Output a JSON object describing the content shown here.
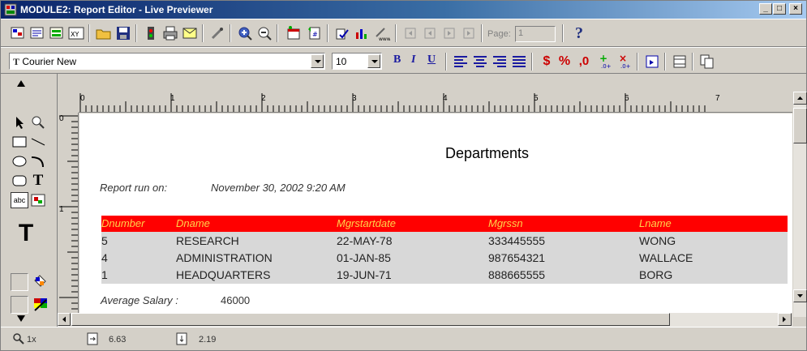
{
  "window": {
    "title": "MODULE2: Report Editor - Live Previewer",
    "minimize_label": "_",
    "maximize_label": "□",
    "close_label": "×"
  },
  "toolbar": {
    "page_label": "Page:",
    "page_value": "1",
    "help_label": "?"
  },
  "format_bar": {
    "font_name": "Courier New",
    "font_size": "10",
    "font_icon_label": "T",
    "bold_label": "B",
    "italic_label": "I",
    "underline_label": "U",
    "percent_label": "%",
    "comma_label": ",0"
  },
  "palette": {
    "text_tool_label": "T",
    "big_text_label": "T",
    "abc_label": "abc"
  },
  "ruler": {
    "h_numbers": [
      "0",
      "1",
      "2",
      "3",
      "4",
      "5",
      "6",
      "7"
    ],
    "v_numbers": [
      "0",
      "1"
    ]
  },
  "report": {
    "title": "Departments",
    "run_on_label": "Report run on:",
    "run_on_value": "November 30, 2002 9:20 AM",
    "columns": [
      "Dnumber",
      "Dname",
      "Mgrstartdate",
      "Mgrssn",
      "Lname"
    ],
    "rows": [
      [
        "5",
        "RESEARCH",
        "22-MAY-78",
        "333445555",
        "WONG"
      ],
      [
        "4",
        "ADMINISTRATION",
        "01-JAN-85",
        "987654321",
        "WALLACE"
      ],
      [
        "1",
        "HEADQUARTERS",
        "19-JUN-71",
        "888665555",
        "BORG"
      ]
    ],
    "avg_label": "Average Salary :",
    "avg_value": "46000"
  },
  "status": {
    "zoom": "1x",
    "x_pos": "6.63",
    "y_pos": "2.19"
  },
  "colors": {
    "header_bg": "#ff0000",
    "header_text": "#ffd24a",
    "body_bg": "#d8d8d8"
  }
}
